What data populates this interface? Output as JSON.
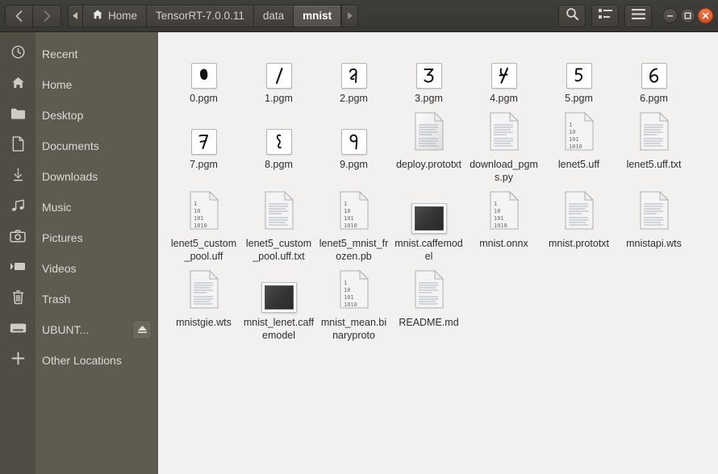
{
  "window": {
    "title": "mnist"
  },
  "header": {
    "nav": {
      "back_icon": "chevron-left-icon",
      "forward_icon": "chevron-right-icon"
    },
    "path_left_arrow": "caret-left-icon",
    "path_right_arrow": "caret-right-icon",
    "breadcrumbs": [
      {
        "label": "Home",
        "icon": "home-icon",
        "active": false
      },
      {
        "label": "TensorRT-7.0.0.11",
        "icon": "",
        "active": false
      },
      {
        "label": "data",
        "icon": "",
        "active": false
      },
      {
        "label": "mnist",
        "icon": "",
        "active": true
      }
    ],
    "tools": [
      {
        "name": "search-button",
        "icon": "search-icon"
      },
      {
        "name": "view-toggle-button",
        "icon": "list-view-icon"
      },
      {
        "name": "menu-button",
        "icon": "hamburger-menu-icon"
      }
    ],
    "window_controls": [
      {
        "name": "minimize-button",
        "icon": "minimize-icon"
      },
      {
        "name": "maximize-button",
        "icon": "maximize-icon"
      },
      {
        "name": "close-button",
        "icon": "close-icon"
      }
    ]
  },
  "sidebar": {
    "items": [
      {
        "label": "Recent",
        "icon": "clock-icon",
        "eject": false
      },
      {
        "label": "Home",
        "icon": "home-icon",
        "eject": false
      },
      {
        "label": "Desktop",
        "icon": "folder-icon",
        "eject": false
      },
      {
        "label": "Documents",
        "icon": "document-icon",
        "eject": false
      },
      {
        "label": "Downloads",
        "icon": "download-icon",
        "eject": false
      },
      {
        "label": "Music",
        "icon": "music-icon",
        "eject": false
      },
      {
        "label": "Pictures",
        "icon": "camera-icon",
        "eject": false
      },
      {
        "label": "Videos",
        "icon": "video-icon",
        "eject": false
      },
      {
        "label": "Trash",
        "icon": "trash-icon",
        "eject": false
      },
      {
        "label": "UBUNT...",
        "icon": "drive-icon",
        "eject": true
      },
      {
        "label": "Other Locations",
        "icon": "plus-icon",
        "eject": false
      }
    ],
    "eject_icon": "eject-icon"
  },
  "files": [
    {
      "label": "0.pgm",
      "icon": "pgm-image-icon",
      "digit": "0"
    },
    {
      "label": "1.pgm",
      "icon": "pgm-image-icon",
      "digit": "1"
    },
    {
      "label": "2.pgm",
      "icon": "pgm-image-icon",
      "digit": "2"
    },
    {
      "label": "3.pgm",
      "icon": "pgm-image-icon",
      "digit": "3"
    },
    {
      "label": "4.pgm",
      "icon": "pgm-image-icon",
      "digit": "4"
    },
    {
      "label": "5.pgm",
      "icon": "pgm-image-icon",
      "digit": "5"
    },
    {
      "label": "6.pgm",
      "icon": "pgm-image-icon",
      "digit": "6"
    },
    {
      "label": "7.pgm",
      "icon": "pgm-image-icon",
      "digit": "7"
    },
    {
      "label": "8.pgm",
      "icon": "pgm-image-icon",
      "digit": "8"
    },
    {
      "label": "9.pgm",
      "icon": "pgm-image-icon",
      "digit": "9"
    },
    {
      "label": "deploy.prototxt",
      "icon": "text-document-icon"
    },
    {
      "label": "download_pgms.py",
      "icon": "text-document-icon"
    },
    {
      "label": "lenet5.uff",
      "icon": "binary-document-icon"
    },
    {
      "label": "lenet5.uff.txt",
      "icon": "text-document-icon"
    },
    {
      "label": "lenet5_custom_pool.uff",
      "icon": "binary-document-icon"
    },
    {
      "label": "lenet5_custom_pool.uff.txt",
      "icon": "text-document-icon"
    },
    {
      "label": "lenet5_mnist_frozen.pb",
      "icon": "binary-document-icon"
    },
    {
      "label": "mnist.caffemodel",
      "icon": "image-thumbnail-icon"
    },
    {
      "label": "mnist.onnx",
      "icon": "binary-document-icon"
    },
    {
      "label": "mnist.prototxt",
      "icon": "text-document-icon"
    },
    {
      "label": "mnistapi.wts",
      "icon": "text-document-icon"
    },
    {
      "label": "mnistgie.wts",
      "icon": "text-document-icon"
    },
    {
      "label": "mnist_lenet.caffemodel",
      "icon": "image-thumbnail-icon"
    },
    {
      "label": "mnist_mean.binaryproto",
      "icon": "binary-document-icon"
    },
    {
      "label": "README.md",
      "icon": "text-document-icon"
    }
  ],
  "binary_icon_lines": [
    "1",
    "10",
    "101",
    "1010"
  ],
  "colors": {
    "headerbar": "#3b3935",
    "sidebar_rail": "#4f4d44",
    "sidebar_list": "#5e5c51",
    "content_bg": "#f2f1ef",
    "close_button": "#e04b16",
    "label_text": "#2e2e2e",
    "sidebar_text": "#dcdad4"
  }
}
